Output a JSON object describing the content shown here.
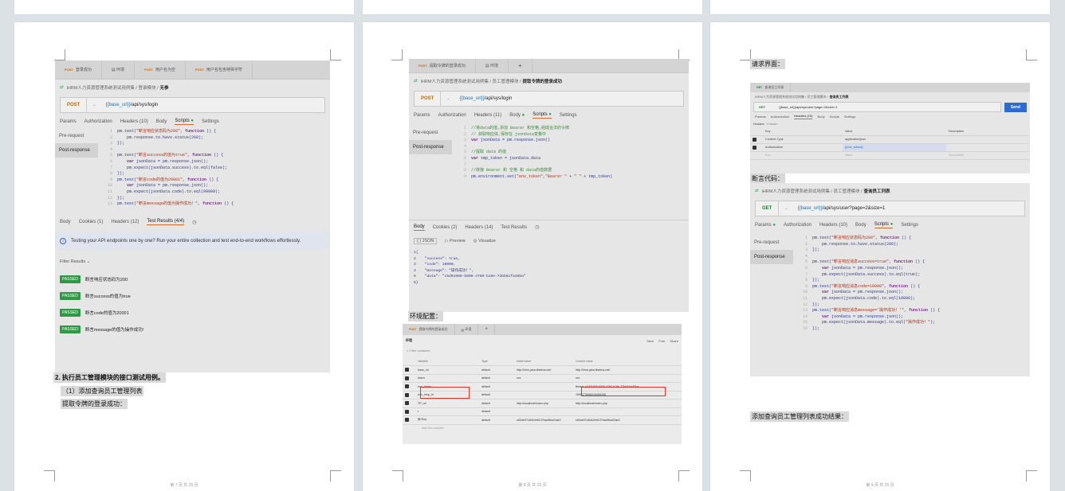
{
  "pages": [
    {
      "footer": "第 7 页 共 25 页",
      "shot": {
        "tabs": [
          {
            "method": "POST",
            "label": "登录成功"
          },
          {
            "method": "",
            "label": "环境"
          },
          {
            "method": "POST",
            "label": "用户名为空"
          },
          {
            "method": "POST",
            "label": "用户名包含特殊字符"
          }
        ],
        "env_icon": "environment-icon",
        "breadcrumb_root": "iHRM人力资源管理系统测试用例集 / 登录模块 /",
        "breadcrumb_current": "无参",
        "method": "POST",
        "url_var": "{{base_url}}",
        "url_path": "/api/sys/login",
        "req_tabs": [
          "Params",
          "Authorization",
          "Headers (10)",
          "Body",
          "Scripts",
          "Settings"
        ],
        "side": [
          "Pre-request",
          "Post-response"
        ],
        "code": [
          [
            "1",
            "pm.test(\"断言响应状态码为200\", function () {"
          ],
          [
            "2",
            "    pm.response.to.have.status(200);"
          ],
          [
            "3",
            "});"
          ],
          [
            "4",
            ""
          ],
          [
            "5",
            "pm.test(\"断言success的值为true\", function () {"
          ],
          [
            "6",
            "    var jsonData = pm.response.json();"
          ],
          [
            "7",
            "    pm.expect(jsonData.success).to.eql(false);"
          ],
          [
            "8",
            "});"
          ],
          [
            "9",
            "pm.test(\"断言code的值为20001\", function () {"
          ],
          [
            "10",
            "    var jsonData = pm.response.json();"
          ],
          [
            "11",
            "    pm.expect(jsonData.code).to.eql(99999);"
          ],
          [
            "12",
            "});"
          ],
          [
            "13",
            "pm.test(\"断言message的值为操作成功！\", function () {"
          ]
        ],
        "resp_tabs": [
          "Body",
          "Cookies (1)",
          "Headers (12)",
          "Test Results (4/4)"
        ],
        "info": "Testing your API endpoints one by one? Run your entire collection and test end-to-end workflows effortlessly.",
        "filter": "Filter Results",
        "badge": "PASSED",
        "results": [
          "断言响应状态码为200",
          "断言success的值为true",
          "断言code的值为20001",
          "断言message的值为操作成功!"
        ]
      },
      "lines": [
        "2. 执行员工管理模块的接口测试用例。",
        "（1）添加查询员工管理列表",
        "提取令牌的登录成功："
      ]
    },
    {
      "footer": "第 8 页 共 25 页",
      "shot": {
        "tabs": [
          {
            "method": "POST",
            "label": "提取令牌的登录成功"
          },
          {
            "method": "",
            "label": "环境"
          },
          {
            "method": "",
            "label": "+"
          }
        ],
        "breadcrumb_root": "iHRM人力资源管理系统测试用例集 / 员工管理模块 /",
        "breadcrumb_current": "提取令牌的登录成功",
        "method": "POST",
        "url_var": "{{base_url}}",
        "url_path": "/api/sys/login",
        "req_tabs": [
          "Params",
          "Authorization",
          "Headers (11)",
          "Body",
          "Scripts",
          "Settings"
        ],
        "side": [
          "Pre-request",
          "Post-response"
        ],
        "code": [
          [
            "1",
            "//将data的值,添加 Bearer 和空格,组成合法的令牌"
          ],
          [
            "2",
            "// 获取响应体,保存在 jsonData变量中"
          ],
          [
            "3",
            "var jsonData = pm.response.json()"
          ],
          [
            "4",
            ""
          ],
          [
            "5",
            "//提取 data 的值"
          ],
          [
            "6",
            "var tmp_token = jsonData.data"
          ],
          [
            "7",
            ""
          ],
          [
            "8",
            "//拼接 Bearer 和 空格 和 data的值数据"
          ],
          [
            "9",
            "pm.environment.set(\"env_token\",\"Bearer \" + \" \" + tmp_token)"
          ]
        ],
        "resp_tabs": [
          "Body",
          "Cookies (2)",
          "Headers (14)",
          "Test Results"
        ],
        "resp_tools": [
          "{ } JSON",
          "Preview",
          "Visualize"
        ],
        "resp_code": [
          [
            "1",
            "{"
          ],
          [
            "2",
            "    \"success\": true,"
          ],
          [
            "3",
            "    \"code\": 10000,"
          ],
          [
            "4",
            "    \"message\": \"操作成功！\","
          ],
          [
            "5",
            "    \"data\": \"c5d01909-b006-4760-b19e-72bb81fa36ba\""
          ],
          [
            "6",
            "}"
          ]
        ]
      },
      "label_env": "环境配置：",
      "env": {
        "tabs": [
          "提取令牌的登录成功",
          "环境",
          "+"
        ],
        "title": "环境",
        "tools": [
          "Save",
          "Fork",
          "Share"
        ],
        "filter": "Filter variables",
        "headers": [
          "Variable",
          "Type",
          "Initial value",
          "Current value"
        ],
        "rows": [
          [
            "base_url",
            "default",
            "http://ihrm-java.itheima.net/",
            "http://ihrm-java.itheima.net/"
          ],
          [
            "token",
            "default",
            "xxx",
            "xxx"
          ],
          [
            "env_token",
            "default",
            "",
            "Bearer c5d01909-b006-4760-b19e-72bb81fa36ba"
          ],
          [
            "env_emp_id",
            "default",
            "",
            "1696173696015408156"
          ],
          [
            "TP_url",
            "default",
            "http://localhost/index.php",
            "http://localhost/index.php"
          ],
          [
            "r",
            "default",
            "",
            ""
          ],
          [
            "库*Key",
            "default",
            "c83de07c8d42e8137bad9ba22ae3",
            "c83de07c8d42e8137bad9ba22ae3"
          ]
        ],
        "add": "Add new variable"
      }
    },
    {
      "footer": "第 9 页 共 25 页",
      "label_req": "请求界面：",
      "req": {
        "tab": "查询员工列表",
        "breadcrumb_root": "iHRM人力资源管理系统测试用例集 / 员工管理模块 /",
        "breadcrumb_current": "查询员工列表",
        "method": "GET",
        "url": "{{base_url}}/api/sys/user?page=2&size=1",
        "send": "Send",
        "tabs": [
          "Params",
          "Authorization",
          "Headers (10)",
          "Body",
          "Scripts",
          "Settings"
        ],
        "headers_label": "Headers",
        "hidden": "9 hidden",
        "cols": [
          "Key",
          "Value",
          "Description"
        ],
        "rows": [
          [
            "Content-Type",
            "application/json",
            ""
          ],
          [
            "Authorization",
            "{{env_token}}",
            ""
          ],
          [
            "Key",
            "Value",
            "Description"
          ]
        ]
      },
      "label_assert": "断言代码：",
      "assert": {
        "breadcrumb_root": "iHRM人力资源管理系统测试用例集 / 员工管理模块 /",
        "breadcrumb_current": "查询员工列表",
        "method": "GET",
        "url_var": "{{base_url}}",
        "url_path": "/api/sys/user?page=2&size=1",
        "req_tabs": [
          "Params",
          "Authorization",
          "Headers (10)",
          "Body",
          "Scripts",
          "Settings"
        ],
        "side": [
          "Pre-request",
          "Post-response"
        ],
        "code": [
          [
            "1",
            "pm.test(\"断言响应状态码为200\", function () {"
          ],
          [
            "2",
            "    pm.response.to.have.status(200);"
          ],
          [
            "3",
            "});"
          ],
          [
            "4",
            ""
          ],
          [
            "5",
            "pm.test(\"断言响应消息success=true\", function () {"
          ],
          [
            "6",
            "    var jsonData = pm.response.json();"
          ],
          [
            "7",
            "    pm.expect(jsonData.success).to.eql(true);"
          ],
          [
            "8",
            "});"
          ],
          [
            "9",
            "pm.test(\"断言响应消息code=10000\", function () {"
          ],
          [
            "10",
            "    var jsonData = pm.response.json();"
          ],
          [
            "11",
            "    pm.expect(jsonData.code).to.eql(10000);"
          ],
          [
            "12",
            "});"
          ],
          [
            "13",
            "pm.test(\"断言响应消息message='操作成功！'\", function () {"
          ],
          [
            "14",
            "    var jsonData = pm.response.json();"
          ],
          [
            "15",
            "    pm.expect(jsonData.message).to.eql(\"操作成功！\");"
          ],
          [
            "16",
            "});"
          ]
        ]
      },
      "label_result": "添加查询员工管理列表成功结果："
    }
  ]
}
